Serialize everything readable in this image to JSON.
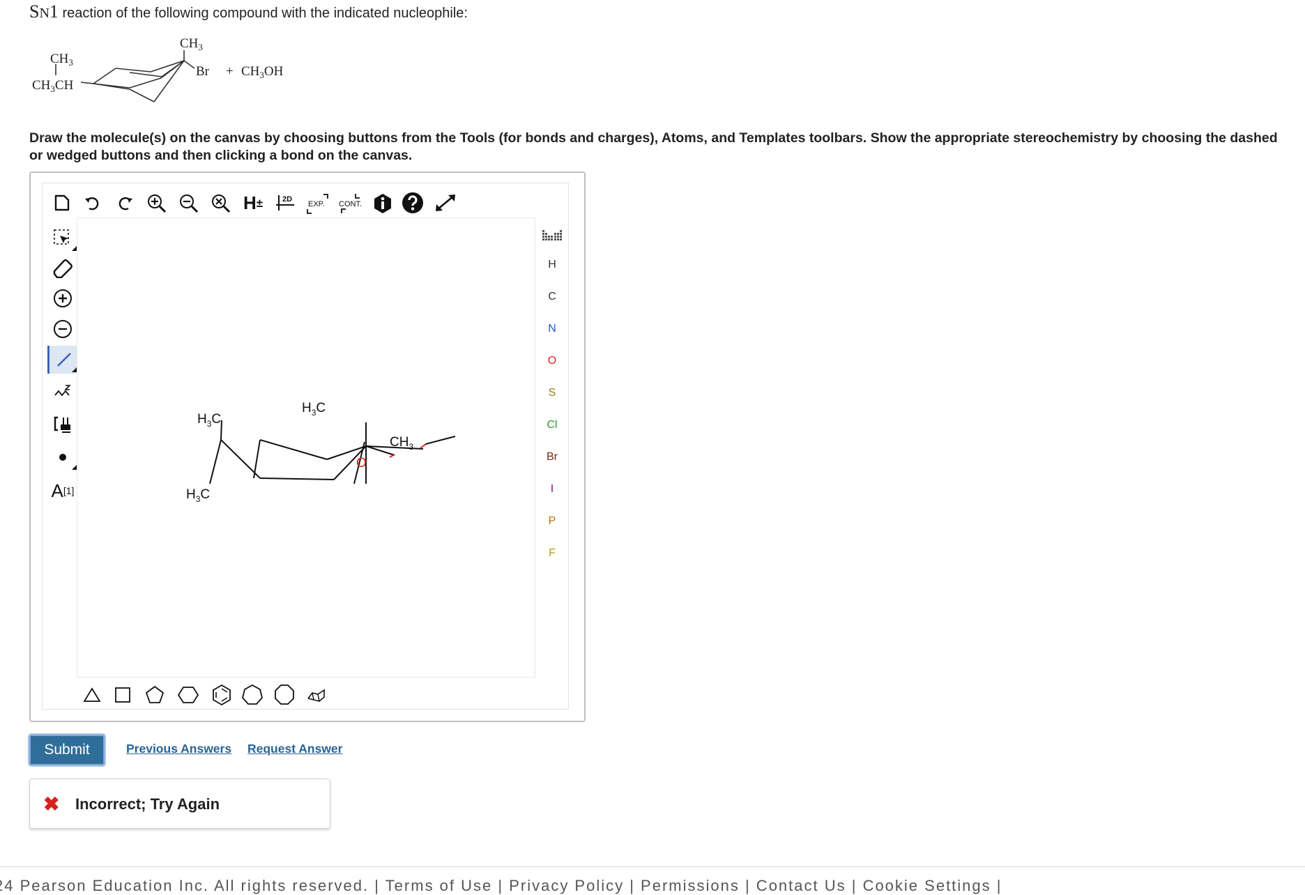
{
  "problem": {
    "title_sn": "S",
    "title_n": "N",
    "title_1": "1",
    "title_rest": " reaction of the following compound with the indicated nucleophile:",
    "reactant": {
      "ch3_top": "CH",
      "ch3_top_sub": "3",
      "ch3_left": "CH",
      "ch3_left_sub": "3",
      "ch3ch_a": "CH",
      "ch3ch_sub": "3",
      "ch3ch_b": "CH",
      "br": "Br",
      "plus": "+",
      "ch3oh_a": "CH",
      "ch3oh_sub": "3",
      "ch3oh_b": "OH"
    }
  },
  "instructions": "Draw the molecule(s) on the canvas by choosing buttons from the Tools (for bonds and charges), Atoms, and Templates toolbars. Show the appropriate stereochemistry by choosing the dashed or wedged buttons and then clicking a bond on the canvas.",
  "toolbar": {
    "h_label": "H",
    "h_pm": "±",
    "twod_label": "2D",
    "exp_label": "EXP.",
    "cont_label": "CONT."
  },
  "left_tools": {
    "label_tool": "A",
    "label_sup": "[1]"
  },
  "atoms": [
    "H",
    "C",
    "N",
    "O",
    "S",
    "Cl",
    "Br",
    "I",
    "P",
    "F"
  ],
  "atom_colors": {
    "H": "#333333",
    "C": "#333333",
    "N": "#2b4fd9",
    "O": "#e0221a",
    "S": "#8a7a14",
    "Cl": "#2b9a2b",
    "Br": "#7a2a14",
    "I": "#6a1a8a",
    "P": "#c26a00",
    "F": "#b59a18"
  },
  "drawn_molecule": {
    "h3c_top_left": "H",
    "h3c_top_left_sub": "3",
    "h3c_top_left_c": "C",
    "h3c_bottom": "H",
    "h3c_bottom_sub": "3",
    "h3c_bottom_c": "C",
    "h3c_top_right": "H",
    "h3c_top_right_sub": "3",
    "h3c_top_right_c": "C",
    "oxygen": "O",
    "ch3_right": "CH",
    "ch3_right_sub": "3"
  },
  "actions": {
    "submit": "Submit",
    "previous_answers": "Previous Answers",
    "request_answer": "Request Answer"
  },
  "feedback": {
    "icon": "✖",
    "text": "Incorrect; Try Again"
  },
  "footer": {
    "text": "24 Pearson Education Inc. All rights reserved.  |  Terms of Use  |  Privacy Policy  |  Permissions  |  Contact Us  |  Cookie Settings  |"
  },
  "colors": {
    "accent": "#2f6e99",
    "link": "#2a6496",
    "error": "#d3231b"
  }
}
